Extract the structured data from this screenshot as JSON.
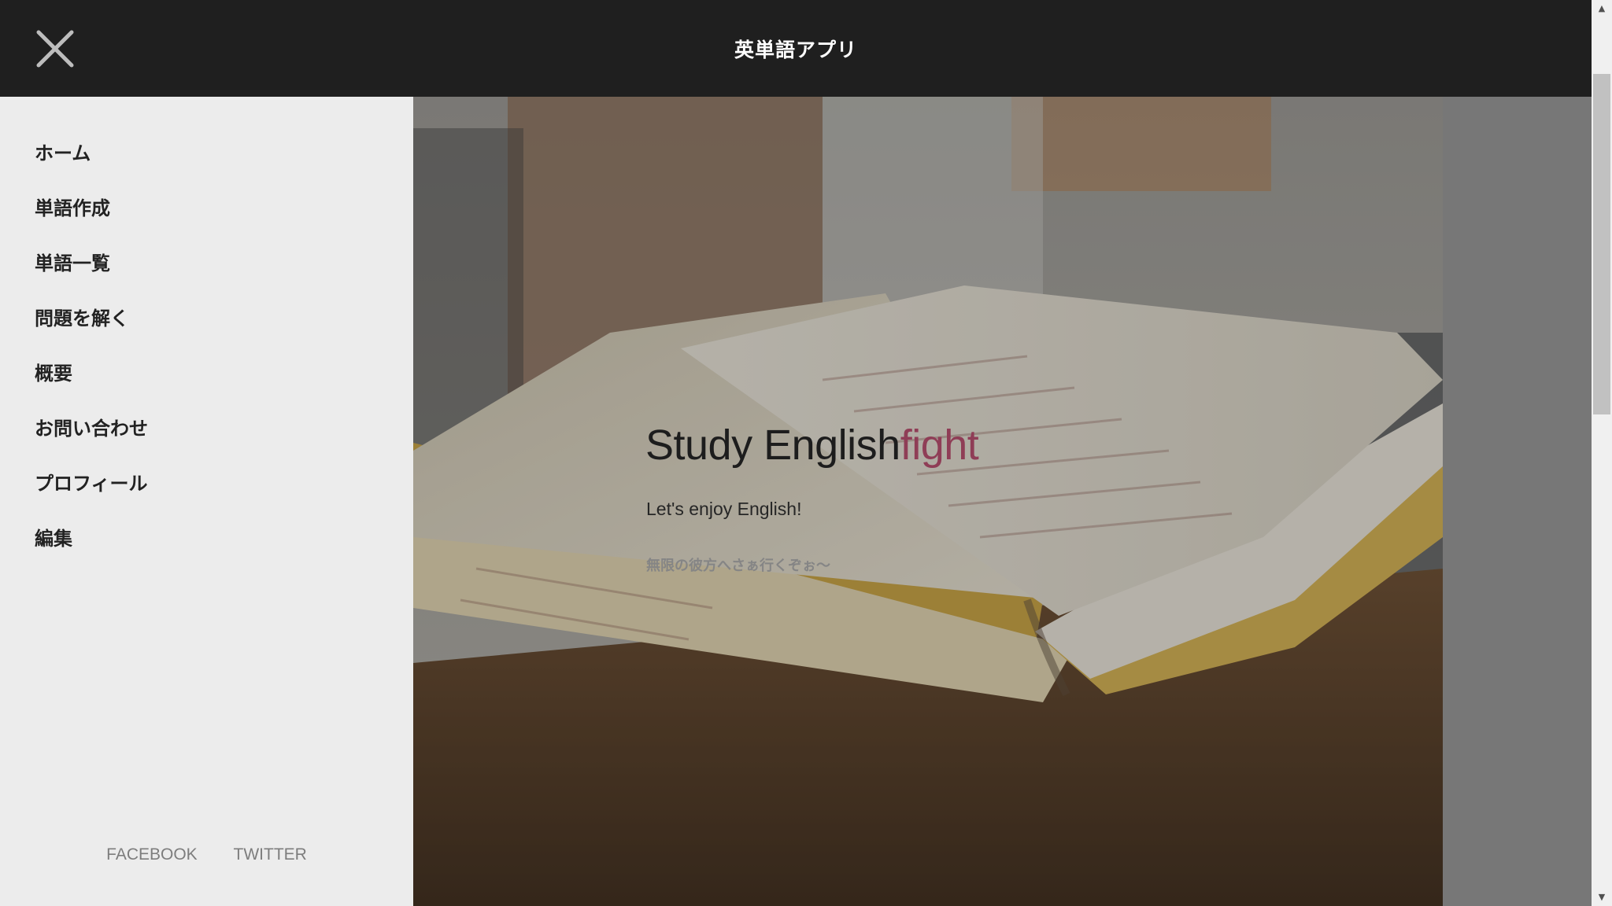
{
  "header": {
    "title": "英単語アプリ",
    "close_icon": "close-icon"
  },
  "sidebar": {
    "items": [
      {
        "label": "ホーム"
      },
      {
        "label": "単語作成"
      },
      {
        "label": "単語一覧"
      },
      {
        "label": "問題を解く"
      },
      {
        "label": "概要"
      },
      {
        "label": "お問い合わせ"
      },
      {
        "label": "プロフィール"
      },
      {
        "label": "編集"
      }
    ],
    "social": {
      "facebook": "FACEBOOK",
      "twitter": "TWITTER"
    }
  },
  "hero": {
    "title_main": "Study English",
    "title_accent": "fight",
    "subtitle": "Let's enjoy English!",
    "note": "無限の彼方へさぁ行くぞぉ～",
    "background_image": "open-book-photo"
  },
  "colors": {
    "header_bg": "#1f1f1f",
    "drawer_bg": "#ececec",
    "accent": "#8f3d56",
    "page_bg": "#777777"
  }
}
